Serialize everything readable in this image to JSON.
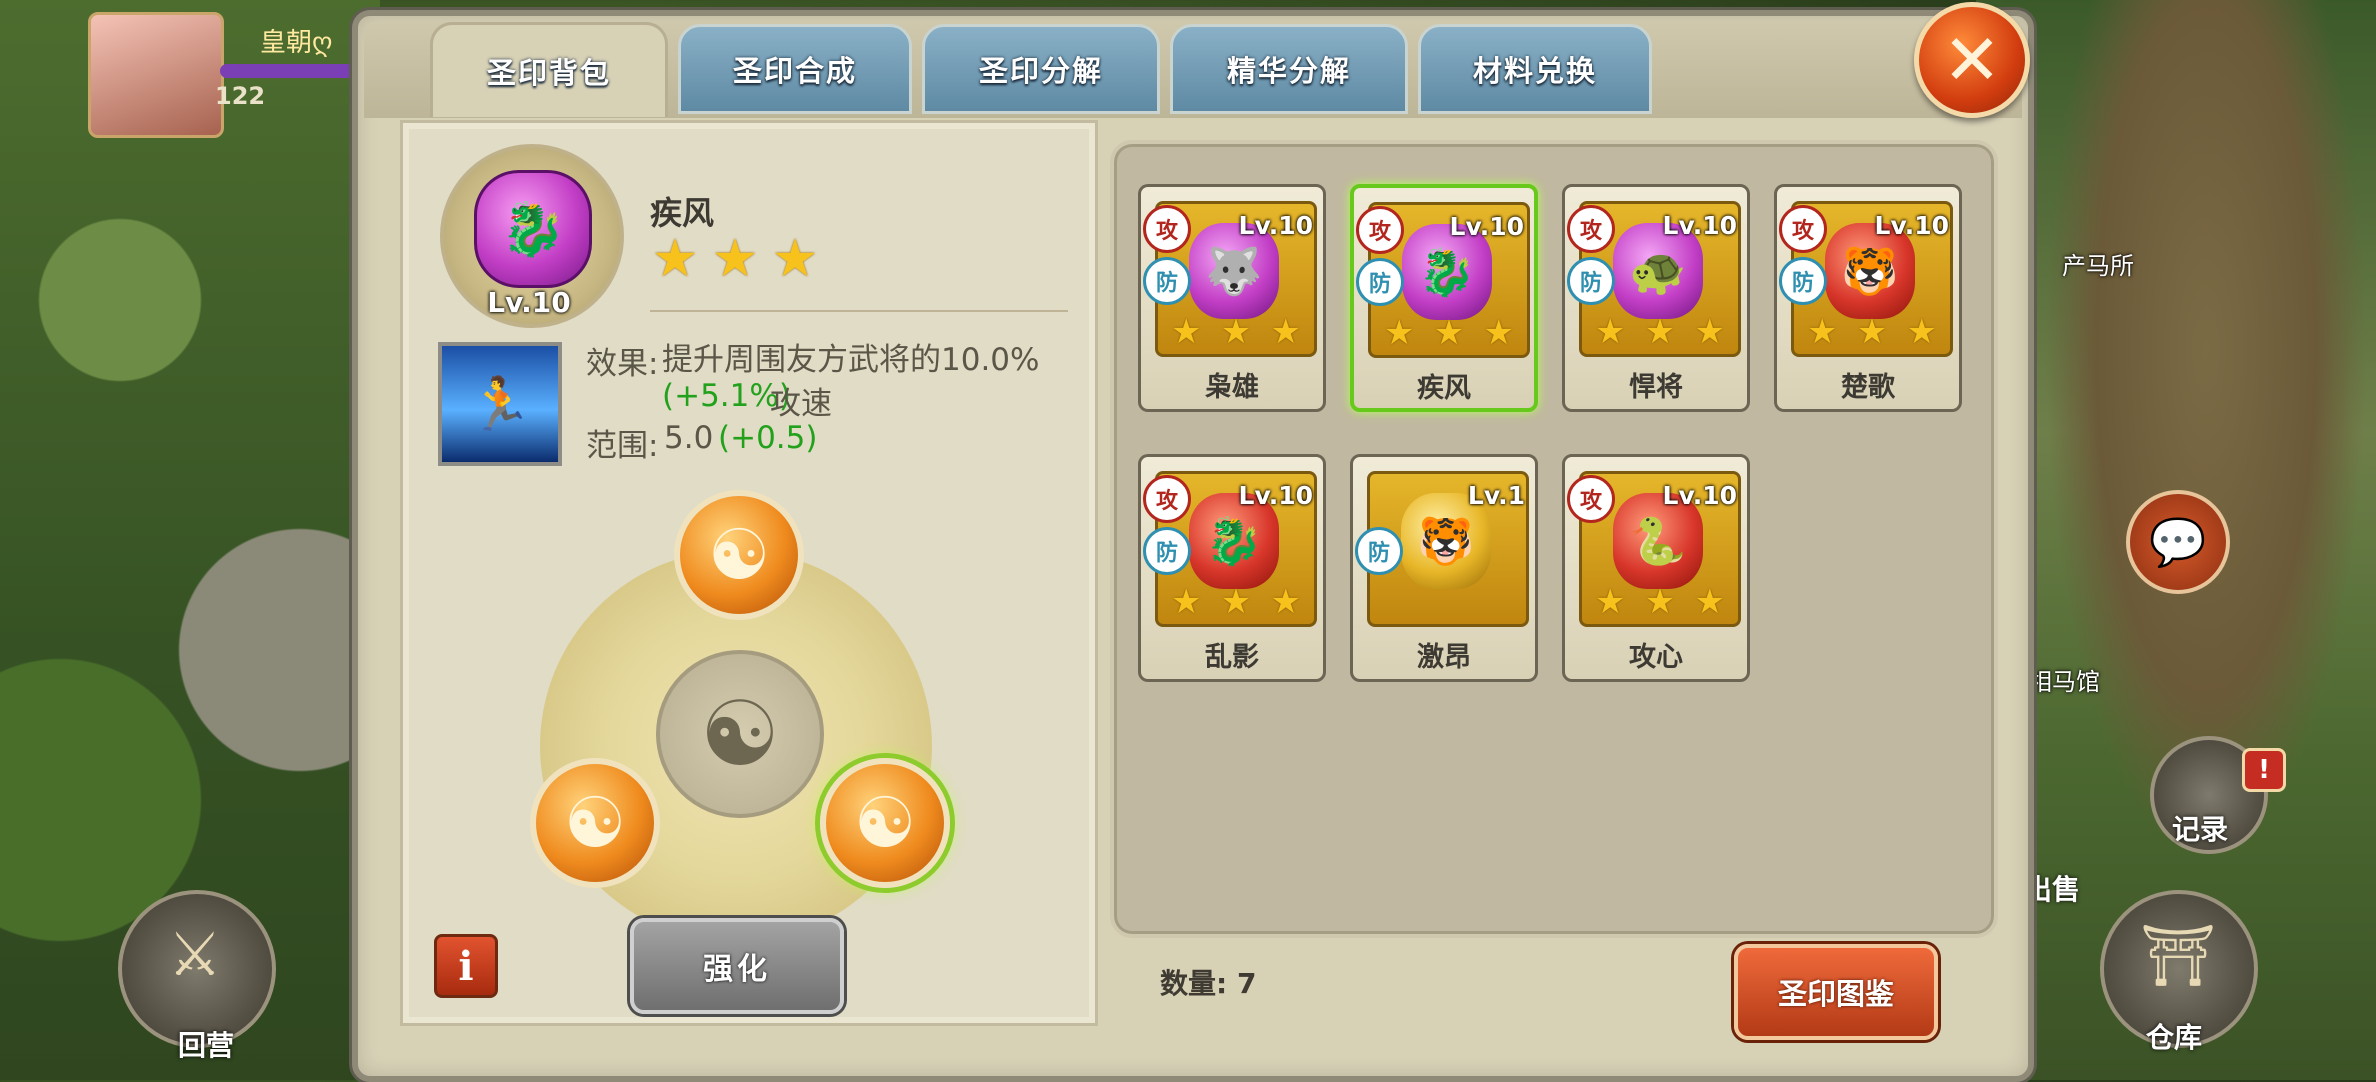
{
  "hud": {
    "player_name": "皇朝ღ",
    "player_level": "122",
    "map_labels": [
      "产马所",
      "相马馆"
    ],
    "bottom_left_label": "回营",
    "bottom_right_label": "仓库",
    "record_label": "记录",
    "sell_label": "出售",
    "notify_badge": "!"
  },
  "tabs": [
    {
      "label": "圣印背包",
      "active": true
    },
    {
      "label": "圣印合成",
      "active": false
    },
    {
      "label": "圣印分解",
      "active": false
    },
    {
      "label": "精华分解",
      "active": false
    },
    {
      "label": "材料兑换",
      "active": false
    }
  ],
  "selected": {
    "name": "疾风",
    "level": "Lv.10",
    "stars": 3,
    "effect_label": "效果:",
    "effect_text": "提升周围友方武将的10.0%",
    "effect_bonus": "(+5.1%)",
    "effect_suffix": "攻速",
    "range_label": "范围:",
    "range_value": "5.0",
    "range_bonus": "(+0.5)"
  },
  "enhance_button": "强化",
  "info_button": "i",
  "items": [
    {
      "name": "枭雄",
      "level": "Lv.10",
      "stars": 3,
      "gem": "purple",
      "icon": "wolf-icon",
      "selected": false
    },
    {
      "name": "疾风",
      "level": "Lv.10",
      "stars": 3,
      "gem": "purple",
      "icon": "dragon-icon",
      "selected": true
    },
    {
      "name": "悍将",
      "level": "Lv.10",
      "stars": 3,
      "gem": "purple",
      "icon": "turtle-icon",
      "selected": false
    },
    {
      "name": "楚歌",
      "level": "Lv.10",
      "stars": 3,
      "gem": "red",
      "icon": "tiger-icon",
      "selected": false
    },
    {
      "name": "乱影",
      "level": "Lv.10",
      "stars": 3,
      "gem": "red",
      "icon": "dragon-icon",
      "selected": false
    },
    {
      "name": "激昂",
      "level": "Lv.1",
      "stars": 0,
      "gem": "gold",
      "icon": "tiger-icon",
      "selected": false
    },
    {
      "name": "攻心",
      "level": "Lv.10",
      "stars": 3,
      "gem": "red",
      "icon": "snake-icon",
      "selected": false
    }
  ],
  "count_label": "数量: 7",
  "atlas_button": "圣印图鉴",
  "colors": {
    "purple_gem": "#c33fc6",
    "red_gem": "#d8362a",
    "gold_gem": "#e8b728",
    "green_text": "#22a11c",
    "tab_blue": "#6f98b1"
  }
}
